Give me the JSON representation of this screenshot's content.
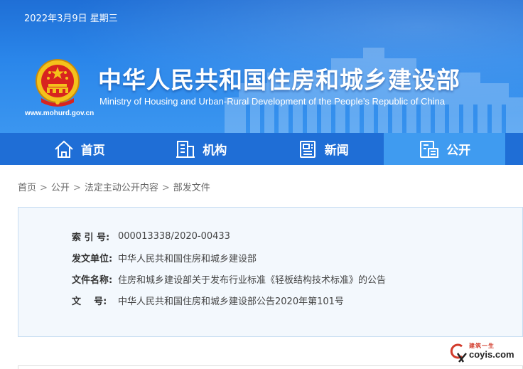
{
  "header": {
    "date": "2022年3月9日 星期三",
    "title_cn": "中华人民共和国住房和城乡建设部",
    "title_en": "Ministry of Housing and Urban-Rural Development of the People’s Republic of China",
    "site_url": "www.mohurd.gov.cn",
    "emblem_icon": "national-emblem-icon",
    "colors": {
      "banner_top": "#1f6fd6",
      "banner_bottom": "#3b96f0"
    }
  },
  "nav": {
    "items": [
      {
        "label": "首页",
        "icon": "home-icon",
        "active": false
      },
      {
        "label": "机构",
        "icon": "building-icon",
        "active": false
      },
      {
        "label": "新闻",
        "icon": "newspaper-icon",
        "active": false
      },
      {
        "label": "公开",
        "icon": "document-open-icon",
        "active": true
      }
    ],
    "colors": {
      "background": "#1f6ed6",
      "active": "#3f9bf0"
    }
  },
  "breadcrumb": {
    "items": [
      "首页",
      "公开",
      "法定主动公开内容",
      "部发文件"
    ],
    "separator": ">"
  },
  "document_info": {
    "rows": [
      {
        "label": "索 引 号:",
        "value": "000013338/2020-00433"
      },
      {
        "label": "发文单位:",
        "value": "中华人民共和国住房和城乡建设部"
      },
      {
        "label": "文件名称:",
        "value": "住房和城乡建设部关于发布行业标准《轻板结构技术标准》的公告"
      },
      {
        "label": "文    号:",
        "value": "中华人民共和国住房和城乡建设部公告2020年第101号"
      }
    ],
    "colors": {
      "background": "#f3f8fd",
      "border": "#c7ddf2"
    }
  },
  "watermark": {
    "small_text": "建筑一生",
    "big_text": "coyis.com",
    "icon": "coyis-logo-icon"
  }
}
